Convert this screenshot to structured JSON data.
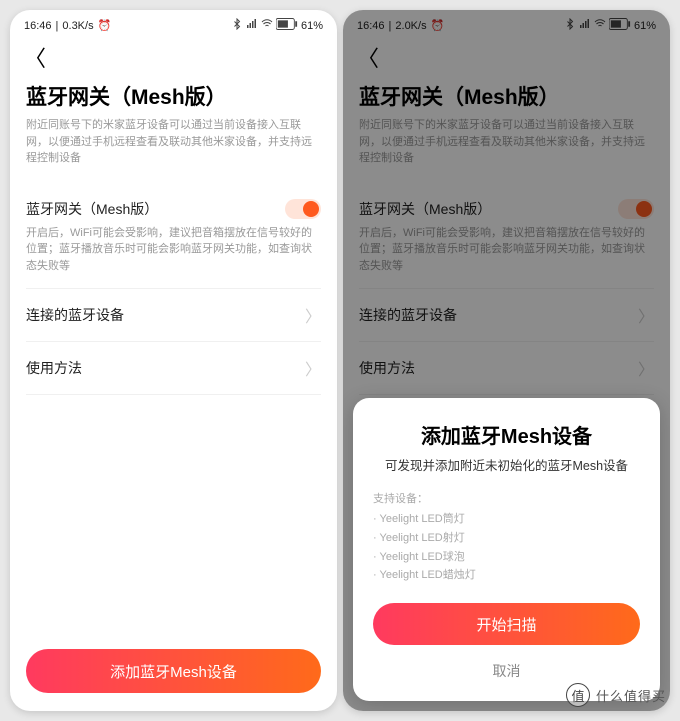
{
  "status": {
    "time": "16:46",
    "speed_left": "0.3K/s",
    "speed_right": "2.0K/s",
    "battery": "61"
  },
  "page": {
    "title": "蓝牙网关（Mesh版）",
    "desc": "附近同账号下的米家蓝牙设备可以通过当前设备接入互联网，以便通过手机远程查看及联动其他米家设备，并支持远程控制设备"
  },
  "toggle_row": {
    "title": "蓝牙网关（Mesh版）",
    "desc": "开启后，WiFi可能会受影响，建议把音箱摆放在信号较好的位置；蓝牙播放音乐时可能会影响蓝牙网关功能，如查询状态失败等"
  },
  "rows": {
    "connected": "连接的蓝牙设备",
    "usage": "使用方法"
  },
  "buttons": {
    "add_mesh": "添加蓝牙Mesh设备"
  },
  "sheet": {
    "title": "添加蓝牙Mesh设备",
    "sub": "可发现并添加附近未初始化的蓝牙Mesh设备",
    "list_head": "支持设备：",
    "items": {
      "0": "Yeelight LED筒灯",
      "1": "Yeelight LED射灯",
      "2": "Yeelight LED球泡",
      "3": "Yeelight LED蜡烛灯"
    },
    "start": "开始扫描",
    "cancel": "取消"
  },
  "watermark": {
    "char": "值",
    "text": "什么值得买"
  }
}
